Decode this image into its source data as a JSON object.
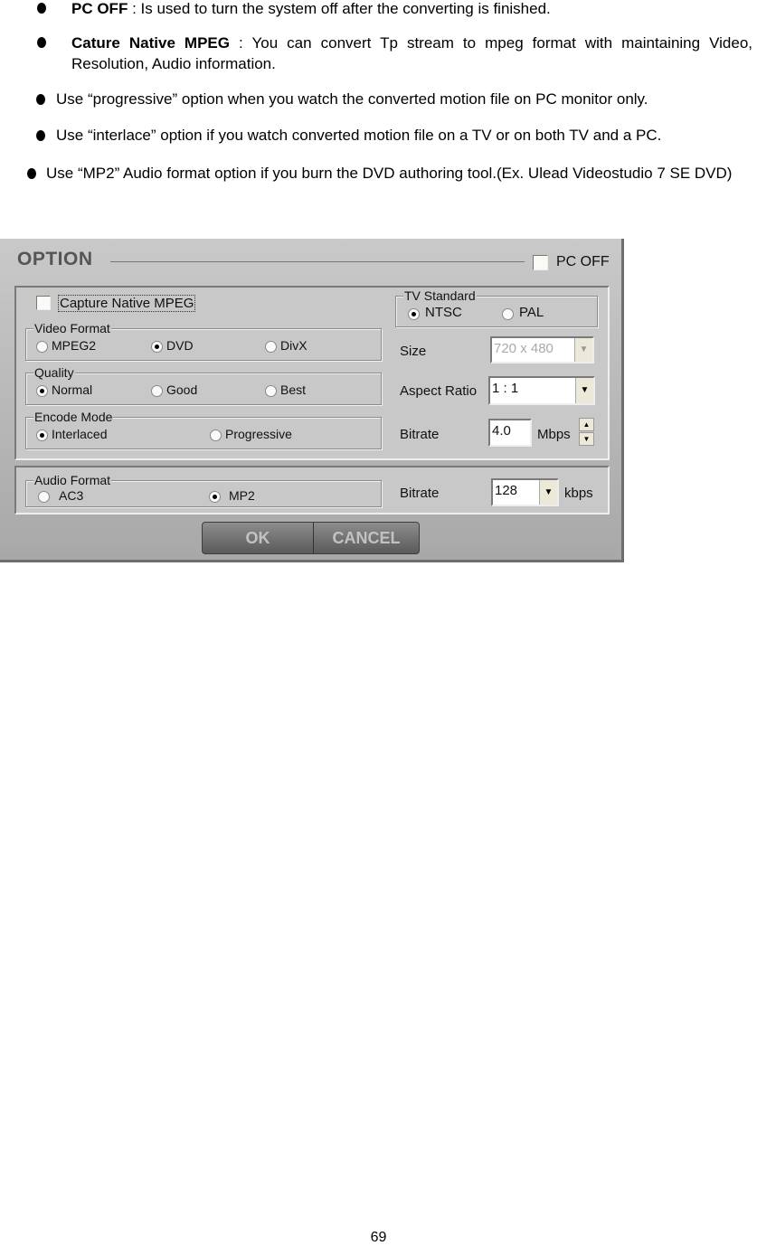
{
  "bullets": [
    {
      "bold": "PC OFF",
      "text": " : Is used to turn the system off after the converting is finished."
    },
    {
      "bold": "Cature Native MPEG",
      "text": " : You can convert Tp stream to mpeg format with maintaining Video, Resolution, Audio information."
    },
    {
      "bold": "",
      "text": "Use “progressive” option when you watch the converted motion file on PC monitor only."
    },
    {
      "bold": "",
      "text": "Use “interlace” option if you watch converted motion file on a TV or on both TV and a PC."
    },
    {
      "bold": "",
      "text": "Use  “MP2”  Audio format option if you burn the DVD authoring tool.(Ex. Ulead Videostudio 7 SE DVD)"
    }
  ],
  "dialog": {
    "title": "OPTION",
    "pc_off": {
      "label": "PC OFF",
      "checked": false
    },
    "capture_native": {
      "label": "Capture Native MPEG",
      "checked": false
    },
    "video_format": {
      "title": "Video Format",
      "options": [
        "MPEG2",
        "DVD",
        "DivX"
      ],
      "selected": "DVD"
    },
    "quality": {
      "title": "Quality",
      "options": [
        "Normal",
        "Good",
        "Best"
      ],
      "selected": "Normal"
    },
    "encode_mode": {
      "title": "Encode Mode",
      "options": [
        "Interlaced",
        "Progressive"
      ],
      "selected": "Interlaced"
    },
    "tv_standard": {
      "title": "TV Standard",
      "options": [
        "NTSC",
        "PAL"
      ],
      "selected": "NTSC"
    },
    "size": {
      "label": "Size",
      "value": "720 x 480"
    },
    "aspect_ratio": {
      "label": "Aspect Ratio",
      "value": "1 : 1"
    },
    "video_bitrate": {
      "label": "Bitrate",
      "value": "4.0",
      "unit": "Mbps"
    },
    "audio_format": {
      "title": "Audio Format",
      "options": [
        "AC3",
        "MP2"
      ],
      "selected": "MP2"
    },
    "audio_bitrate": {
      "label": "Bitrate",
      "value": "128",
      "unit": "kbps"
    },
    "ok_label": "OK",
    "cancel_label": "CANCEL"
  },
  "page_number": "69"
}
